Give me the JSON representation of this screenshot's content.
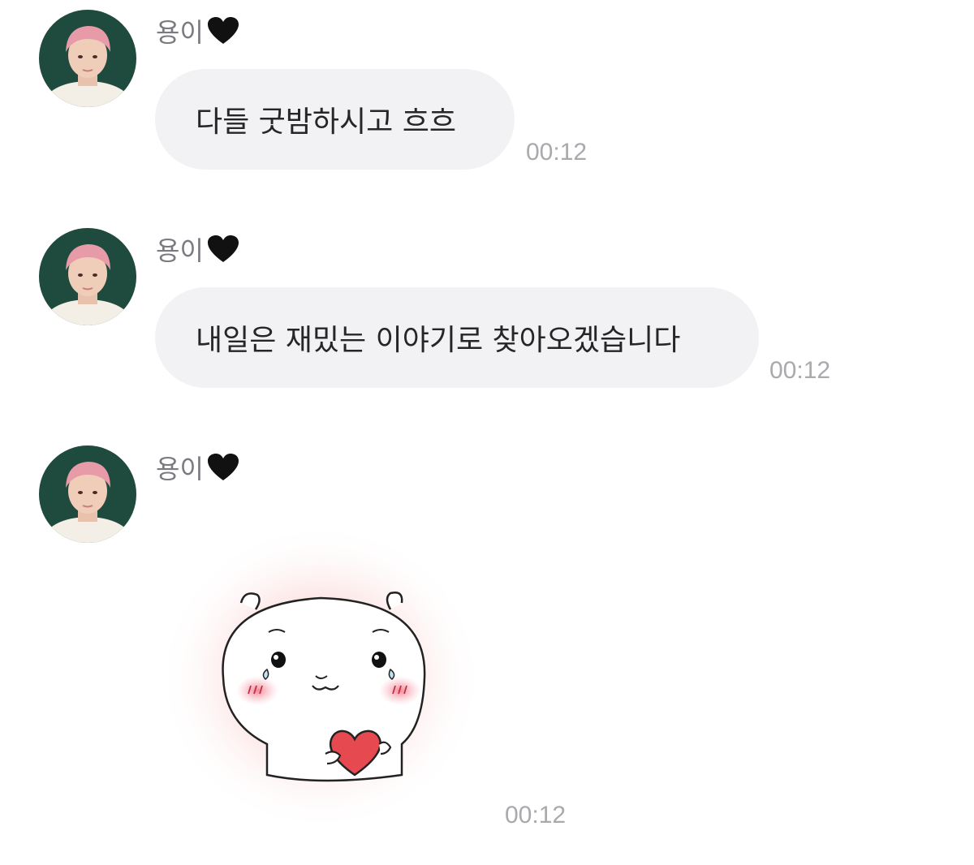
{
  "messages": [
    {
      "sender": "용이",
      "text": "다들 굿밤하시고 흐흐",
      "time": "00:12"
    },
    {
      "sender": "용이",
      "text": "내일은 재밌는 이야기로 찾아오겠습니다",
      "time": "00:12"
    },
    {
      "sender": "용이",
      "sticker": "crying-hamster-holding-heart-sticker",
      "time": "00:12"
    }
  ],
  "icons": {
    "sender_heart": "black-heart-icon",
    "avatar": "avatar"
  },
  "colors": {
    "bubble": "#f2f2f5",
    "text": "#262626",
    "sender": "#7a7a80",
    "time": "#a9a9ae",
    "heart": "#111111"
  }
}
